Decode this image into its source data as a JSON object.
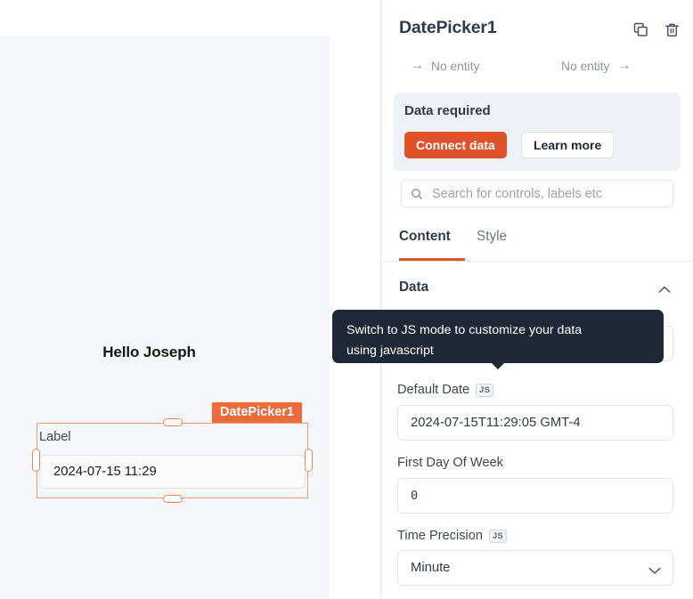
{
  "canvas": {
    "greeting": "Hello Joseph",
    "widget": {
      "badge": "DatePicker1",
      "label": "Label",
      "value": "2024-07-15 11:29"
    }
  },
  "panel": {
    "title": "DatePicker1",
    "icons": {
      "duplicate": "copy-icon",
      "delete": "trash-icon"
    },
    "entity_nav": {
      "prev_label": "No entity",
      "next_label": "No entity"
    },
    "data_required": {
      "title": "Data required",
      "connect_label": "Connect data",
      "learn_more_label": "Learn more"
    },
    "search": {
      "placeholder": "Search for controls, labels etc",
      "value": ""
    },
    "tabs": [
      {
        "label": "Content",
        "active": true
      },
      {
        "label": "Style",
        "active": false
      }
    ],
    "sections": [
      {
        "title": "Data",
        "expanded": true,
        "fields": [
          {
            "label": "Default Date",
            "js": "JS",
            "value": "2024-07-15T11:29:05 GMT-4",
            "type": "text"
          },
          {
            "label": "First Day Of Week",
            "js": "",
            "value": "0",
            "type": "number"
          },
          {
            "label": "Time Precision",
            "js": "JS",
            "value": "Minute",
            "type": "select"
          }
        ]
      }
    ]
  },
  "tooltip": {
    "text": "Switch to JS mode to customize your data\nusing javascript"
  },
  "colors": {
    "accent": "#e0532a",
    "badge": "#ec6b3c",
    "selection": "#f1997e",
    "tooltip_bg": "#1e2836",
    "panel_bg_muted": "#eef1f6",
    "canvas_bg": "#f6f7f9",
    "text_primary": "#2f3b4c",
    "text_muted": "#8c94a3"
  }
}
